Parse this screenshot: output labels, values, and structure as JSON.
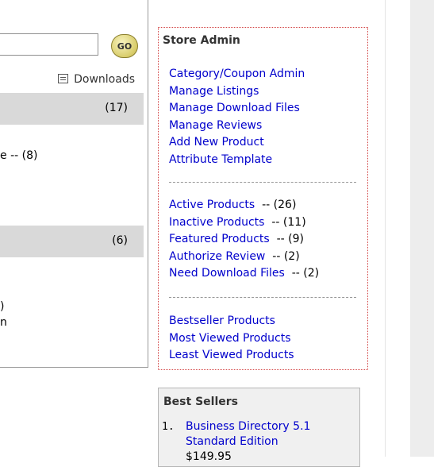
{
  "left": {
    "go_label": "GO",
    "downloads_label": "Downloads",
    "category1_count": "(17)",
    "line1": "e -- (8)",
    "category2_count": "(6)",
    "line2": ")",
    "line3": "n"
  },
  "store_admin": {
    "title": "Store Admin",
    "links": [
      "Category/Coupon Admin",
      "Manage Listings",
      "Manage Download Files",
      "Manage Reviews",
      "Add New Product",
      "Attribute Template"
    ],
    "status_links": [
      {
        "label": "Active Products",
        "count": "  -- (26)"
      },
      {
        "label": "Inactive Products",
        "count": "  -- (11)"
      },
      {
        "label": "Featured Products",
        "count": "  -- (9)"
      },
      {
        "label": "Authorize Review",
        "count": "  -- (2)"
      },
      {
        "label": "Need Download Files",
        "count": "  -- (2)"
      }
    ],
    "report_links": [
      "Bestseller Products",
      "Most Viewed Products",
      "Least Viewed Products"
    ]
  },
  "best_sellers": {
    "title": "Best Sellers",
    "items": [
      {
        "num": "1.",
        "line1": "Business Directory 5.1",
        "line2": "Standard Edition",
        "price": "$149.95"
      }
    ]
  }
}
